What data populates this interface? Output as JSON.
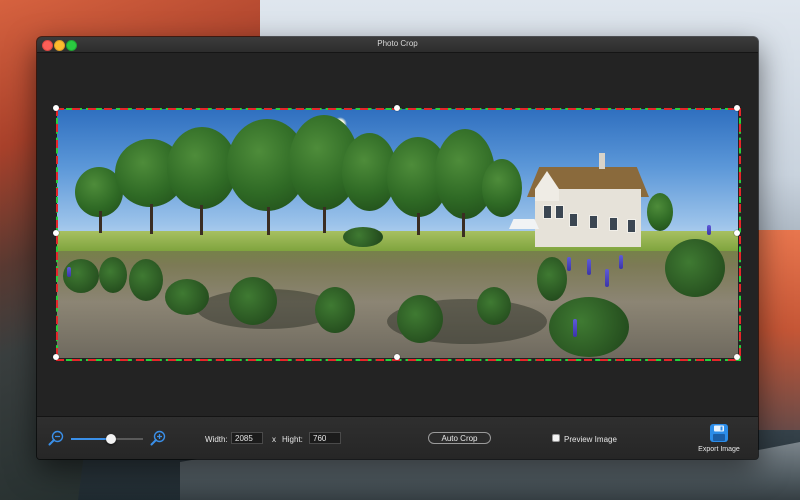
{
  "window": {
    "title": "Photo Crop"
  },
  "toolbar": {
    "zoom_out_icon": "zoom-out-icon",
    "zoom_in_icon": "zoom-in-icon",
    "zoom_level": 0.55,
    "width_label": "Width:",
    "width_value": "2085",
    "times_label": "x",
    "height_label": "Hight:",
    "height_value": "760",
    "auto_crop_label": "Auto Crop",
    "preview_label": "Preview Image",
    "preview_checked": false,
    "export_label": "Export Image",
    "export_icon": "export-disk-icon"
  },
  "colors": {
    "crop_dash_primary": "#27d13c",
    "crop_dash_secondary": "#e5262a",
    "slider_accent": "#3a8fe8",
    "export_icon": "#2b8ce8"
  }
}
